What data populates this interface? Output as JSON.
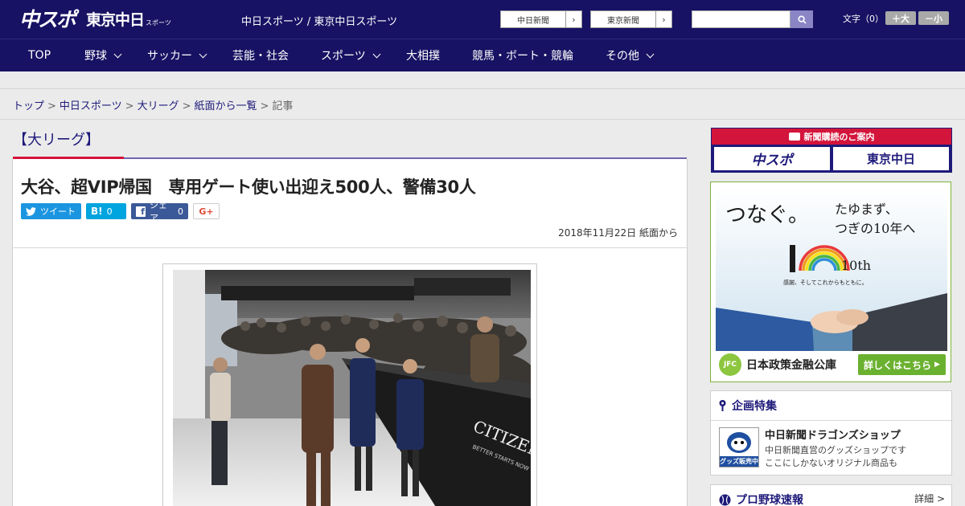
{
  "header": {
    "logo_chu": "中スポ",
    "logo_tokyo": "東京中日",
    "logo_sports": "スポーツ",
    "site_links": "中日スポーツ / 東京中日スポーツ",
    "ext_buttons": [
      {
        "label": "中日新聞"
      },
      {
        "label": "東京新聞"
      }
    ],
    "search": {
      "placeholder": ""
    },
    "font_label": "文字（0）",
    "font_up": "＋大",
    "font_down": "－小"
  },
  "nav": {
    "items": [
      {
        "label": "TOP"
      },
      {
        "label": "野球"
      },
      {
        "label": "サッカー"
      },
      {
        "label": "芸能・社会"
      },
      {
        "label": "スポーツ"
      },
      {
        "label": "大相撲"
      },
      {
        "label": "競馬・ボート・競輪"
      },
      {
        "label": "その他"
      }
    ]
  },
  "breadcrumb": {
    "items": [
      "トップ",
      "中日スポーツ",
      "大リーグ",
      "紙面から一覧"
    ],
    "current": "記事",
    "sep": ">"
  },
  "article": {
    "category": "【大リーグ】",
    "headline": "大谷、超VIP帰国　専用ゲート使い出迎え500人、警備30人",
    "share": {
      "tweet": "ツイート",
      "hatena_icon": "B!",
      "hatena_count": "0",
      "facebook_label": "シェア",
      "facebook_count": "0",
      "gplus": "G+"
    },
    "dateline": "2018年11月22日 紙面から",
    "photo_sign": "CITIZEN",
    "photo_sign_sub": "BETTER STARTS NOW"
  },
  "sidebar": {
    "subscription_header": "新聞購読のご案内",
    "sub_buttons": [
      {
        "label": "中スポ"
      },
      {
        "label": "東京中日"
      }
    ],
    "ad": {
      "line1": "つなぐ。",
      "line2": "たゆまず、",
      "line3": "つぎの10年へ",
      "anniv": "10th",
      "tagline": "感謝、そしてこれからもともに。",
      "org": "日本政策金融公庫",
      "org_mark": "JFC",
      "cta": "詳しくはこちら"
    },
    "panel1": {
      "title": "企画特集",
      "item_title": "中日新聞ドラゴンズショップ",
      "item_desc1": "中日新聞直営のグッズショップです",
      "item_desc2": "ここにしかないオリジナル商品も",
      "badge": "グッズ販売中"
    },
    "panel2": {
      "title": "プロ野球速報",
      "more": "詳細 >"
    }
  },
  "colors": {
    "brand": "#171263",
    "accent_red": "#d3143b",
    "link": "#1e1a7a"
  }
}
